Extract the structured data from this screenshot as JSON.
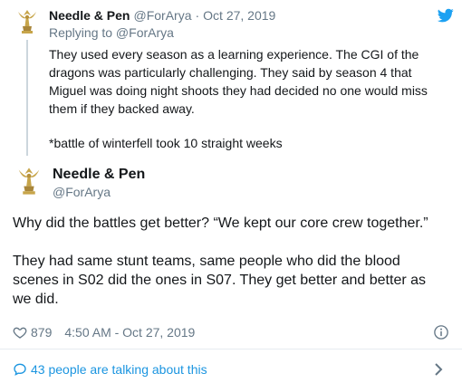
{
  "parent_tweet": {
    "author_name": "Needle & Pen",
    "handle": "@ForArya",
    "separator": "·",
    "date": "Oct 27, 2019",
    "replying_to": "Replying to @ForArya",
    "text_paragraphs": [
      "They used every season as a learning experience. The CGI of the dragons was particularly challenging. They said by season 4 that Miguel was doing night shoots they had decided no one would miss them if they backed away.",
      "*battle of winterfell took 10 straight weeks"
    ]
  },
  "tweet": {
    "author_name": "Needle & Pen",
    "handle": "@ForArya",
    "text_paragraphs": [
      "Why did the battles get better? “We kept our core crew together.”",
      "They had same stunt teams, same people who did the blood scenes in S02 did the ones in S07. They get better and better as we did."
    ],
    "like_count": "879",
    "timestamp": "4:50 AM - Oct 27, 2019"
  },
  "footer": {
    "talking_about": "43 people are talking about this"
  },
  "icons": {
    "brand": "twitter-bird-icon",
    "like": "heart-icon",
    "info": "info-icon",
    "conversation": "speech-bubble-icon",
    "more": "chevron-right-icon",
    "avatar": "emmy-statuette-avatar"
  },
  "colors": {
    "text": "#14171a",
    "secondary": "#657786",
    "link": "#1b95e0",
    "twitter_blue": "#1da1f2",
    "thread_line": "#ccd6dd",
    "divider": "#e6ecf0",
    "avatar_gold": "#c7a54a"
  }
}
